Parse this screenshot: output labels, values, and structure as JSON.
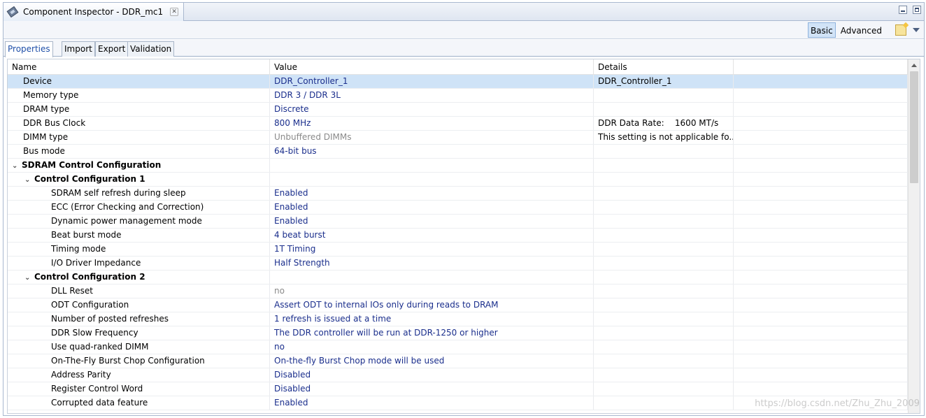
{
  "window": {
    "title": "Component Inspector - DDR_mc1",
    "close_glyph": "✕",
    "icon": "chip-icon"
  },
  "toolbar": {
    "basic_label": "Basic",
    "advanced_label": "Advanced"
  },
  "tabs": [
    {
      "label": "Properties"
    },
    {
      "label": "Import"
    },
    {
      "label": "Export"
    },
    {
      "label": "Validation"
    }
  ],
  "table": {
    "headers": {
      "name": "Name",
      "value": "Value",
      "details": "Details"
    },
    "rows": [
      {
        "name": "Device",
        "value": "DDR_Controller_1",
        "details": "DDR_Controller_1"
      },
      {
        "name": "Memory type",
        "value": "DDR 3 / DDR 3L",
        "details": ""
      },
      {
        "name": "DRAM type",
        "value": "Discrete",
        "details": ""
      },
      {
        "name": "DDR Bus Clock",
        "value": "800 MHz",
        "details": "DDR Data Rate:    1600 MT/s"
      },
      {
        "name": "DIMM type",
        "value": "Unbuffered DIMMs",
        "details": "This setting is not applicable fo..."
      },
      {
        "name": "Bus mode",
        "value": "64-bit bus",
        "details": ""
      },
      {
        "name": "SDRAM Control Configuration",
        "value": "",
        "details": ""
      },
      {
        "name": "Control Configuration 1",
        "value": "",
        "details": ""
      },
      {
        "name": "SDRAM self refresh during sleep",
        "value": "Enabled",
        "details": ""
      },
      {
        "name": "ECC (Error Checking and Correction)",
        "value": "Enabled",
        "details": ""
      },
      {
        "name": "Dynamic power management mode",
        "value": "Enabled",
        "details": ""
      },
      {
        "name": "Beat burst mode",
        "value": "4 beat burst",
        "details": ""
      },
      {
        "name": "Timing mode",
        "value": "1T Timing",
        "details": ""
      },
      {
        "name": "I/O Driver Impedance",
        "value": "Half Strength",
        "details": ""
      },
      {
        "name": "Control Configuration 2",
        "value": "",
        "details": ""
      },
      {
        "name": "DLL Reset",
        "value": "no",
        "details": ""
      },
      {
        "name": "ODT Configuration",
        "value": "Assert ODT to internal IOs only during reads to DRAM",
        "details": ""
      },
      {
        "name": "Number of posted refreshes",
        "value": "1 refresh is issued at a time",
        "details": ""
      },
      {
        "name": "DDR Slow Frequency",
        "value": "The DDR controller will be run at DDR-1250 or higher",
        "details": ""
      },
      {
        "name": "Use quad-ranked DIMM",
        "value": "no",
        "details": ""
      },
      {
        "name": "On-The-Fly Burst Chop Configuration",
        "value": "On-the-fly Burst Chop mode will be used",
        "details": ""
      },
      {
        "name": "Address Parity",
        "value": "Disabled",
        "details": ""
      },
      {
        "name": "Register Control Word",
        "value": "Disabled",
        "details": ""
      },
      {
        "name": "Corrupted data feature",
        "value": "Enabled",
        "details": ""
      }
    ]
  },
  "watermark": "https://blog.csdn.net/Zhu_Zhu_2009"
}
